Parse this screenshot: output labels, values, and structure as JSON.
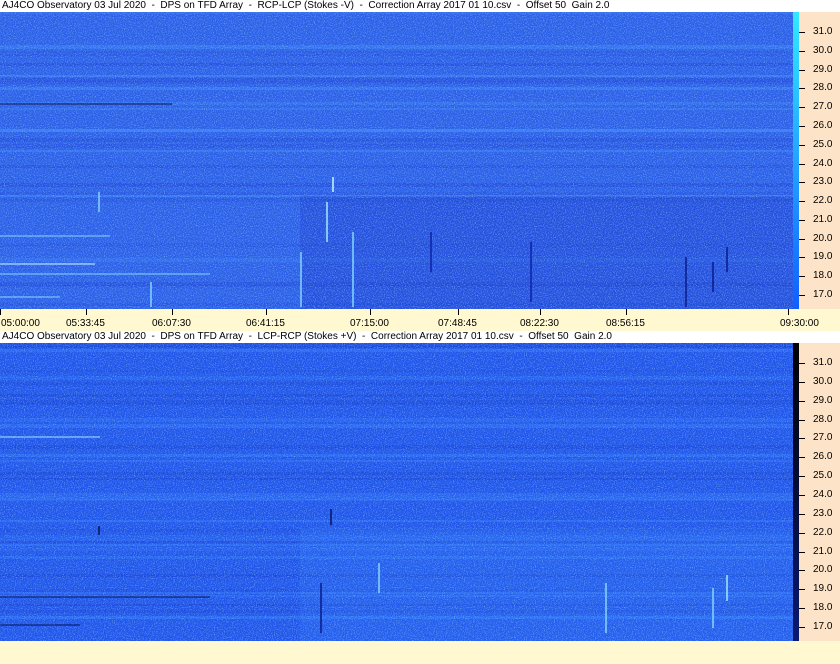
{
  "panels": [
    {
      "title": "AJ4CO Observatory 03 Jul 2020  -  DPS on TFD Array  -  RCP-LCP (Stokes -V)  -  Correction Array 2017 01 10.csv  -  Offset 50  Gain 2.0",
      "base_color": "#2a5fe8",
      "dark_color": "#1c3ed0",
      "light_color": "#4aa8ff",
      "colorbar_top": "#33e8ff",
      "colorbar_bottom": "#1060ff",
      "freq_ticks": [
        "31.0",
        "30.0",
        "29.0",
        "28.0",
        "27.0",
        "26.0",
        "25.0",
        "24.0",
        "23.0",
        "22.0",
        "21.0",
        "20.0",
        "19.0",
        "18.0",
        "17.0"
      ]
    },
    {
      "title": "AJ4CO Observatory 03 Jul 2020  -  DPS on TFD Array  -  LCP-RCP (Stokes +V)  -  Correction Array 2017 01 10.csv  -  Offset 50  Gain 2.0",
      "base_color": "#1f55ea",
      "dark_color": "#153cc8",
      "light_color": "#3a8cff",
      "colorbar_top": "#000000",
      "colorbar_bottom": "#0a1a70",
      "freq_ticks": [
        "31.0",
        "30.0",
        "29.0",
        "28.0",
        "27.0",
        "26.0",
        "25.0",
        "24.0",
        "23.0",
        "22.0",
        "21.0",
        "20.0",
        "19.0",
        "18.0",
        "17.0"
      ]
    }
  ],
  "time_axis": {
    "ticks": [
      "05:00:00",
      "05:33:45",
      "06:07:30",
      "06:41:15",
      "07:15:00",
      "07:48:45",
      "08:22:30",
      "08:56:15",
      "09:30:00"
    ]
  },
  "chart_data": [
    {
      "type": "heatmap",
      "title": "AJ4CO Observatory 03 Jul 2020  -  DPS on TFD Array  -  RCP-LCP (Stokes -V)  -  Correction Array 2017 01 10.csv  -  Offset 50  Gain 2.0",
      "x_ticks": [
        "05:00:00",
        "05:33:45",
        "06:07:30",
        "06:41:15",
        "07:15:00",
        "07:48:45",
        "08:22:30",
        "08:56:15",
        "09:30:00"
      ],
      "y_ticks": [
        31.0,
        30.0,
        29.0,
        28.0,
        27.0,
        26.0,
        25.0,
        24.0,
        23.0,
        22.0,
        21.0,
        20.0,
        19.0,
        18.0,
        17.0
      ],
      "ylim": [
        16.3,
        31.8
      ]
    },
    {
      "type": "heatmap",
      "title": "AJ4CO Observatory 03 Jul 2020  -  DPS on TFD Array  -  LCP-RCP (Stokes +V)  -  Correction Array 2017 01 10.csv  -  Offset 50  Gain 2.0",
      "y_ticks": [
        31.0,
        30.0,
        29.0,
        28.0,
        27.0,
        26.0,
        25.0,
        24.0,
        23.0,
        22.0,
        21.0,
        20.0,
        19.0,
        18.0,
        17.0
      ],
      "ylim": [
        16.3,
        31.8
      ]
    }
  ]
}
